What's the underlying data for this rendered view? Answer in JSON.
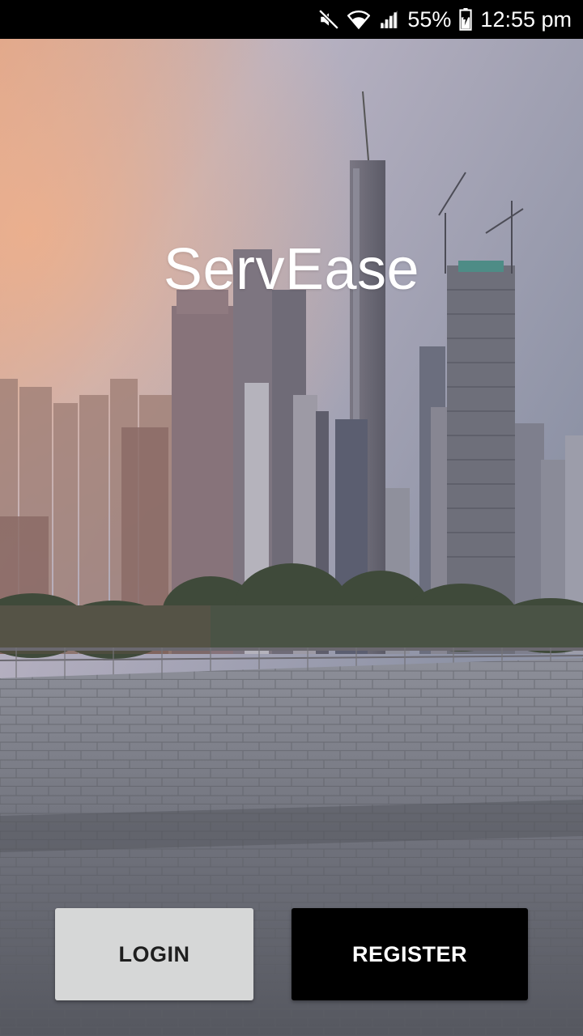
{
  "status_bar": {
    "battery": "55%",
    "time": "12:55 pm",
    "icons": [
      "mute-icon",
      "wifi-icon",
      "signal-icon",
      "battery-icon"
    ]
  },
  "app": {
    "title": "ServEase"
  },
  "buttons": {
    "login_label": "LOGIN",
    "register_label": "REGISTER"
  },
  "colors": {
    "login_bg": "#d6d7d7",
    "register_bg": "#000000",
    "title_text": "#ffffff"
  }
}
